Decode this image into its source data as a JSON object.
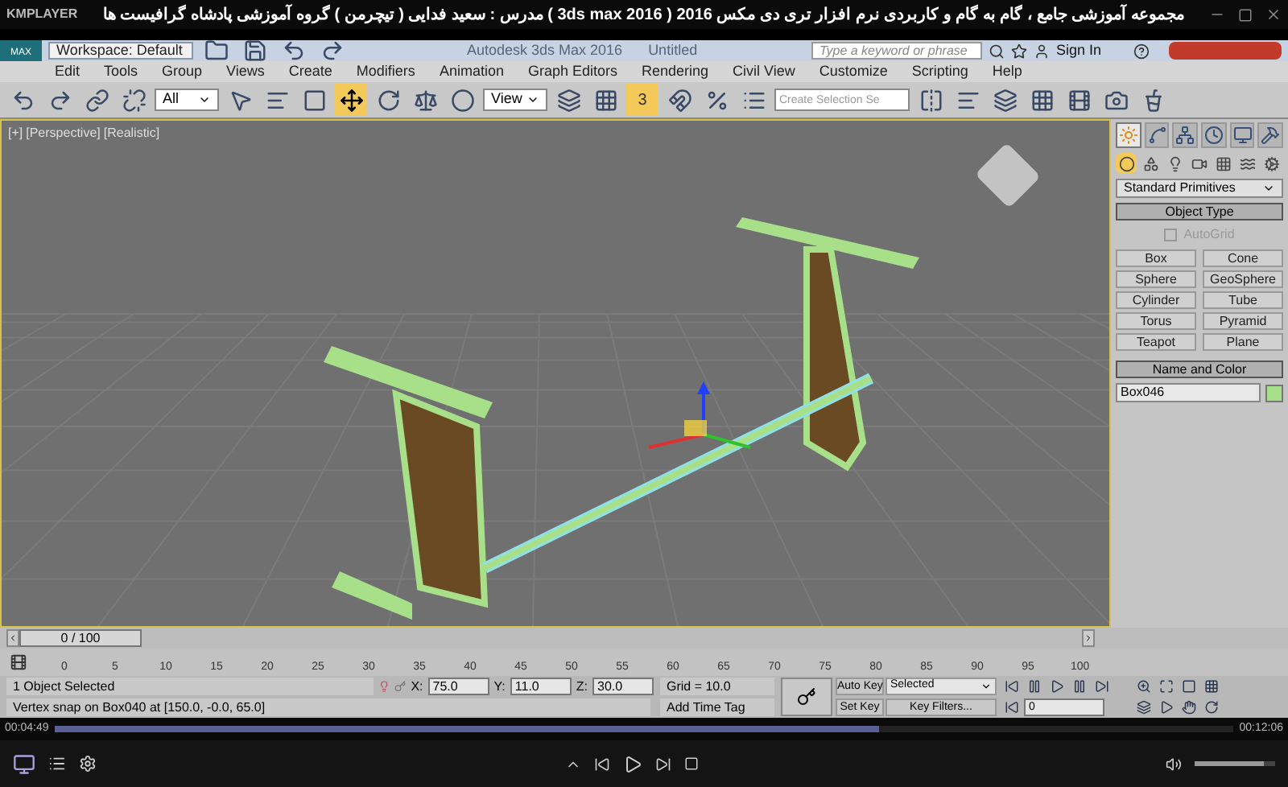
{
  "player": {
    "logo": "KMPLAYER",
    "title": "مجموعه آموزشی جامع ، گام به گام و کاربردی نرم افزار تری دی مکس 2016 ( 3ds max 2016 ) مدرس : سعید فدایی ( تیچرمن ) گروه آموزشی پادشاه گرافیست ها",
    "elapsed": "00:04:49",
    "total": "00:12:06",
    "progress": {
      "level": 0.7
    },
    "volume": {
      "level": 0.85
    }
  },
  "app": {
    "icon_label": "MAX",
    "workspace": "Workspace: Default",
    "title": "Autodesk 3ds Max 2016",
    "document": "Untitled",
    "search": {
      "placeholder": "Type a keyword or phrase"
    },
    "sign_in": "Sign In"
  },
  "menu": [
    "Edit",
    "Tools",
    "Group",
    "Views",
    "Create",
    "Modifiers",
    "Animation",
    "Graph Editors",
    "Rendering",
    "Civil View",
    "Customize",
    "Scripting",
    "Help"
  ],
  "toolbar": {
    "selection_filter": "All",
    "reference_coord": "View",
    "snap_toggle": "3",
    "named_selection": {
      "placeholder": "Create Selection Se"
    }
  },
  "viewport": {
    "labels": [
      "[+]",
      "[Perspective]",
      "[Realistic]"
    ]
  },
  "command_panel": {
    "tabs": [
      {
        "kind": "create",
        "selected": true
      },
      {
        "kind": "modify",
        "selected": false
      },
      {
        "kind": "hierarchy",
        "selected": false
      },
      {
        "kind": "motion",
        "selected": false
      },
      {
        "kind": "display",
        "selected": false
      },
      {
        "kind": "utilities",
        "selected": false
      }
    ],
    "categories": [
      {
        "kind": "geometry",
        "selected": true
      },
      {
        "kind": "shapes",
        "selected": false
      },
      {
        "kind": "lights",
        "selected": false
      },
      {
        "kind": "cameras",
        "selected": false
      },
      {
        "kind": "helpers",
        "selected": false
      },
      {
        "kind": "spacewarps",
        "selected": false
      },
      {
        "kind": "systems",
        "selected": false
      }
    ],
    "dropdown": "Standard Primitives",
    "object_type": {
      "title": "Object Type",
      "autogrid": {
        "label": "AutoGrid",
        "checked": false,
        "disabled": true
      },
      "buttons": [
        "Box",
        "Cone",
        "Sphere",
        "GeoSphere",
        "Cylinder",
        "Tube",
        "Torus",
        "Pyramid",
        "Teapot",
        "Plane"
      ]
    },
    "name_and_color": {
      "title": "Name and Color",
      "name": "Box046",
      "color": "#a8e08a"
    }
  },
  "time_slider": {
    "label": "0 / 100",
    "level": 0
  },
  "track_bar": {
    "ticks": [
      "0",
      "5",
      "10",
      "15",
      "20",
      "25",
      "30",
      "35",
      "40",
      "45",
      "50",
      "55",
      "60",
      "65",
      "70",
      "75",
      "80",
      "85",
      "90",
      "95",
      "100"
    ]
  },
  "status": {
    "selected": "1 Object Selected",
    "prompt": "Vertex snap on Box040 at [150.0, -0.0, 65.0]",
    "coords": [
      {
        "label": "X:",
        "value": "75.0"
      },
      {
        "label": "Y:",
        "value": "11.0"
      },
      {
        "label": "Z:",
        "value": "30.0"
      }
    ],
    "grid": "Grid = 10.0",
    "add_time_tag": "Add Time Tag",
    "auto_key": "Auto Key",
    "key_mode": "Selected",
    "set_key": "Set Key",
    "key_filters": "Key Filters...",
    "frame": "0"
  }
}
